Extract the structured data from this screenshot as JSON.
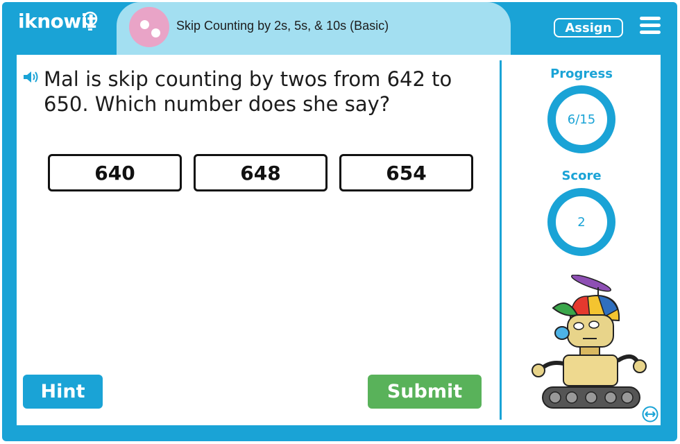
{
  "header": {
    "logo_text": "iknowit",
    "lesson_title": "Skip Counting by 2s, 5s, & 10s (Basic)",
    "assign_label": "Assign",
    "menu_icon": "hamburger-menu-icon"
  },
  "question": {
    "text": "Mal is skip counting by twos from 642 to 650. Which number does she say?",
    "audio_icon": "speaker-icon"
  },
  "answers": [
    "640",
    "648",
    "654"
  ],
  "buttons": {
    "hint_label": "Hint",
    "submit_label": "Submit"
  },
  "sidebar": {
    "progress_label": "Progress",
    "progress_value": "6/15",
    "score_label": "Score",
    "score_value": "2"
  },
  "colors": {
    "brand_blue": "#1aa3d6",
    "title_bar": "#a3dff1",
    "submit_green": "#59b25a",
    "lesson_badge_pink": "#e9a4c7"
  }
}
